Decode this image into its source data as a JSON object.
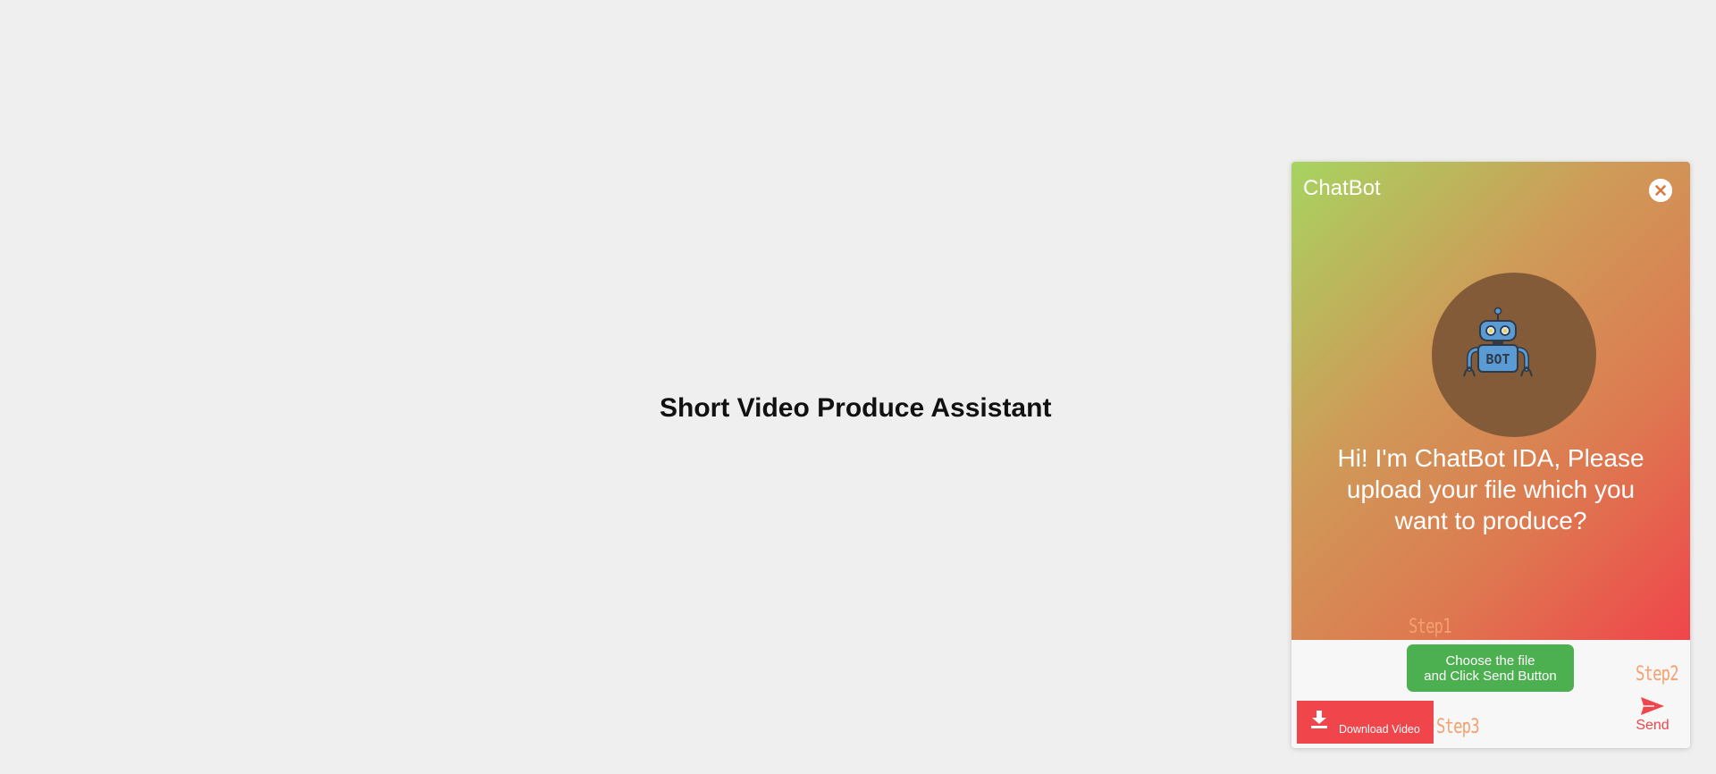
{
  "page": {
    "title": "Short Video Produce Assistant"
  },
  "chatbot": {
    "header_title": "ChatBot",
    "close_icon": "close-circle-icon",
    "avatar_icon": "robot-icon",
    "avatar_badge_text": "BOT",
    "greeting": "Hi! I'm ChatBot IDA, Please upload your file which you want to produce?",
    "step1_label": "Step1",
    "step2_label": "Step2",
    "step3_label": "Step3",
    "choose_file_line1": "Choose the file",
    "choose_file_line2": "and Click Send Button",
    "send_icon": "paper-plane-icon",
    "send_label": "Send",
    "download_icon": "download-icon",
    "download_label": "Download Video"
  },
  "colors": {
    "page_background": "#efefef",
    "gradient_start": "#a7d460",
    "gradient_end": "#f0454b",
    "avatar_background": "#835b38",
    "choose_button": "#4caf50",
    "accent_red": "#f0454b",
    "step_label": "#f4a070"
  }
}
